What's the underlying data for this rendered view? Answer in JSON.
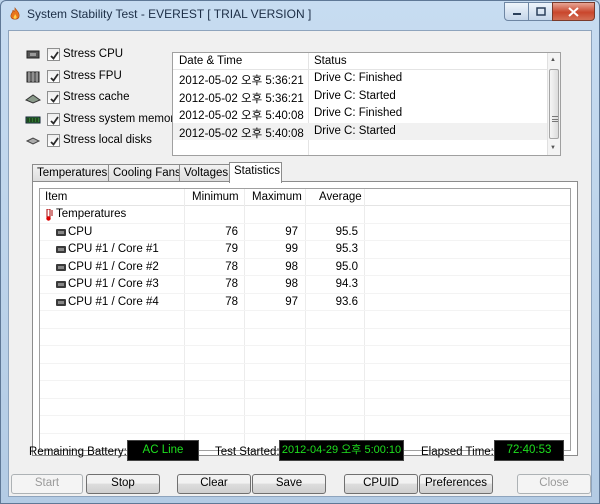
{
  "window": {
    "title": "System Stability Test - EVEREST  [ TRIAL VERSION ]",
    "icons": [
      "flame-app-icon",
      "minimize-icon",
      "maximize-icon",
      "close-icon"
    ]
  },
  "stress": [
    {
      "label": "Stress CPU",
      "checked": true,
      "icon": "cpu-icon"
    },
    {
      "label": "Stress FPU",
      "checked": true,
      "icon": "fpu-icon"
    },
    {
      "label": "Stress cache",
      "checked": true,
      "icon": "cache-icon"
    },
    {
      "label": "Stress system memory",
      "checked": true,
      "icon": "memory-icon"
    },
    {
      "label": "Stress local disks",
      "checked": true,
      "icon": "disk-icon"
    }
  ],
  "log": {
    "headers": [
      "Date & Time",
      "Status"
    ],
    "rows": [
      {
        "datetime": "2012-05-02 오후 5:36:21",
        "status": "Drive C: Finished"
      },
      {
        "datetime": "2012-05-02 오후 5:36:21",
        "status": "Drive C: Started"
      },
      {
        "datetime": "2012-05-02 오후 5:40:08",
        "status": "Drive C: Finished"
      },
      {
        "datetime": "2012-05-02 오후 5:40:08",
        "status": "Drive C: Started"
      }
    ]
  },
  "tabs": [
    {
      "label": "Temperatures",
      "active": false
    },
    {
      "label": "Cooling Fans",
      "active": false
    },
    {
      "label": "Voltages",
      "active": false
    },
    {
      "label": "Statistics",
      "active": true
    }
  ],
  "stats": {
    "headers": [
      "Item",
      "Minimum",
      "Maximum",
      "Average"
    ],
    "group": "Temperatures",
    "rows": [
      {
        "item": "CPU",
        "min": "76",
        "max": "97",
        "avg": "95.5"
      },
      {
        "item": "CPU #1 / Core #1",
        "min": "79",
        "max": "99",
        "avg": "95.3"
      },
      {
        "item": "CPU #1 / Core #2",
        "min": "78",
        "max": "98",
        "avg": "95.0"
      },
      {
        "item": "CPU #1 / Core #3",
        "min": "78",
        "max": "98",
        "avg": "94.3"
      },
      {
        "item": "CPU #1 / Core #4",
        "min": "78",
        "max": "97",
        "avg": "93.6"
      }
    ]
  },
  "status": {
    "battery_label": "Remaining Battery:",
    "battery_value": "AC Line",
    "started_label": "Test Started:",
    "started_value": "2012-04-29 오후 5:00:10",
    "elapsed_label": "Elapsed Time:",
    "elapsed_value": "72:40:53"
  },
  "buttons": {
    "start": "Start",
    "stop": "Stop",
    "clear": "Clear",
    "save": "Save",
    "cpuid": "CPUID",
    "preferences": "Preferences",
    "close": "Close"
  },
  "colors": {
    "lcd_text": "#1ee01e",
    "lcd_bg": "#000000"
  }
}
